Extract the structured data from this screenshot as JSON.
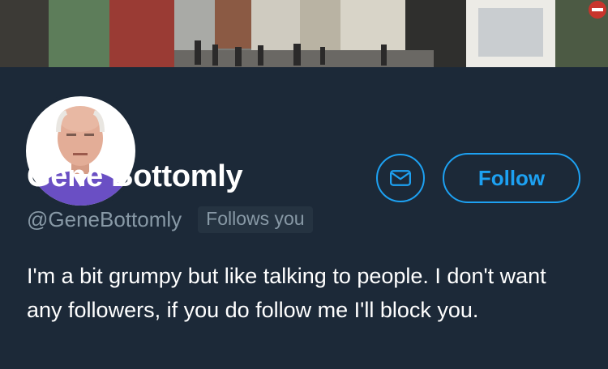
{
  "profile": {
    "name": "Gene Bottomly",
    "handle": "@GeneBottomly",
    "follows_you": "Follows you",
    "bio": "I'm a bit grumpy but like talking to people. I don't want any followers, if you do follow me I'll block you."
  },
  "actions": {
    "message_icon": "envelope-icon",
    "follow_label": "Follow"
  },
  "colors": {
    "background": "#1c2938",
    "accent": "#1da1f2",
    "secondary_text": "#8899a6"
  }
}
